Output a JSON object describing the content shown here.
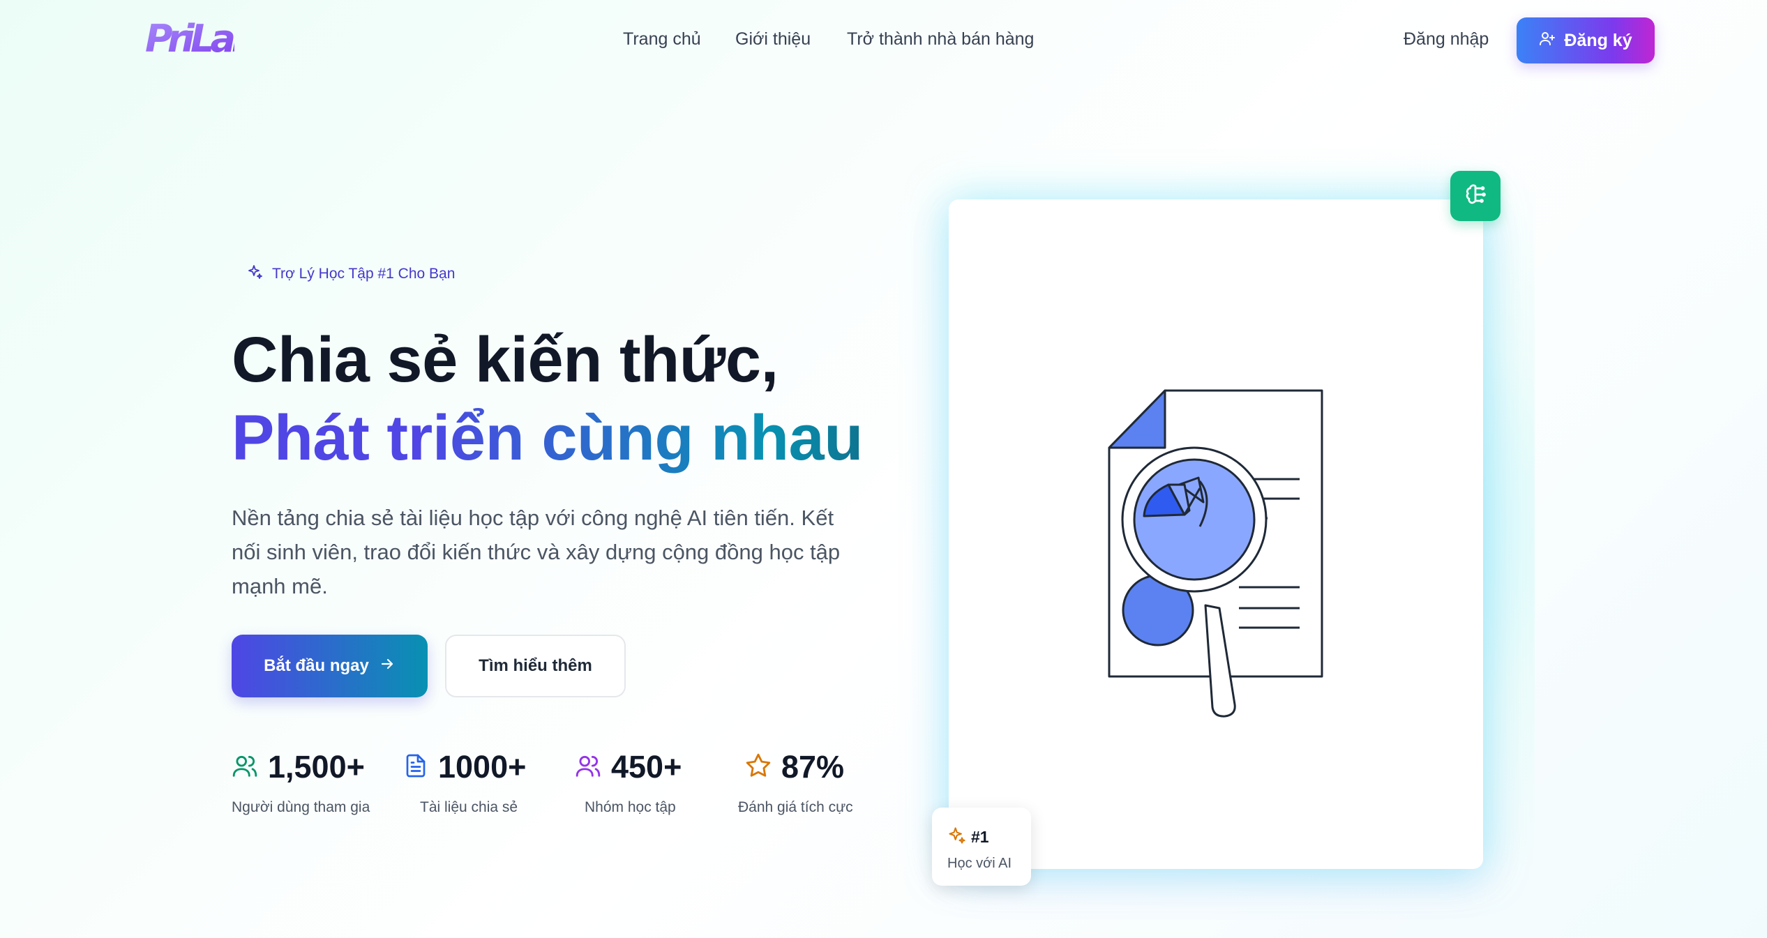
{
  "header": {
    "logo_text": "PriLab",
    "nav": [
      {
        "label": "Trang chủ"
      },
      {
        "label": "Giới thiệu"
      },
      {
        "label": "Trở thành nhà bán hàng"
      }
    ],
    "login_label": "Đăng nhập",
    "signup_label": "Đăng ký"
  },
  "hero": {
    "tagline": "Trợ Lý Học Tập #1 Cho Bạn",
    "title_line1": "Chia sẻ kiến thức,",
    "title_line2": "Phát triển cùng nhau",
    "description": "Nền tảng chia sẻ tài liệu học tập với công nghệ AI tiên tiến. Kết nối sinh viên, trao đổi kiến thức và xây dựng cộng đồng học tập mạnh mẽ.",
    "primary_cta": "Bắt đầu ngay",
    "secondary_cta": "Tìm hiểu thêm"
  },
  "stats": [
    {
      "value": "1,500+",
      "label": "Người dùng tham gia",
      "icon": "users-icon",
      "color": "#059669"
    },
    {
      "value": "1000+",
      "label": "Tài liệu chia sẻ",
      "icon": "document-icon",
      "color": "#2563eb"
    },
    {
      "value": "450+",
      "label": "Nhóm học tập",
      "icon": "group-icon",
      "color": "#9333ea"
    },
    {
      "value": "87%",
      "label": "Đánh giá tích cực",
      "icon": "star-icon",
      "color": "#d97706"
    }
  ],
  "badge": {
    "rank": "#1",
    "text": "Học với AI"
  },
  "colors": {
    "accent_indigo": "#4f46e5",
    "accent_cyan": "#0891b2",
    "ai_badge_green": "#10b981"
  }
}
